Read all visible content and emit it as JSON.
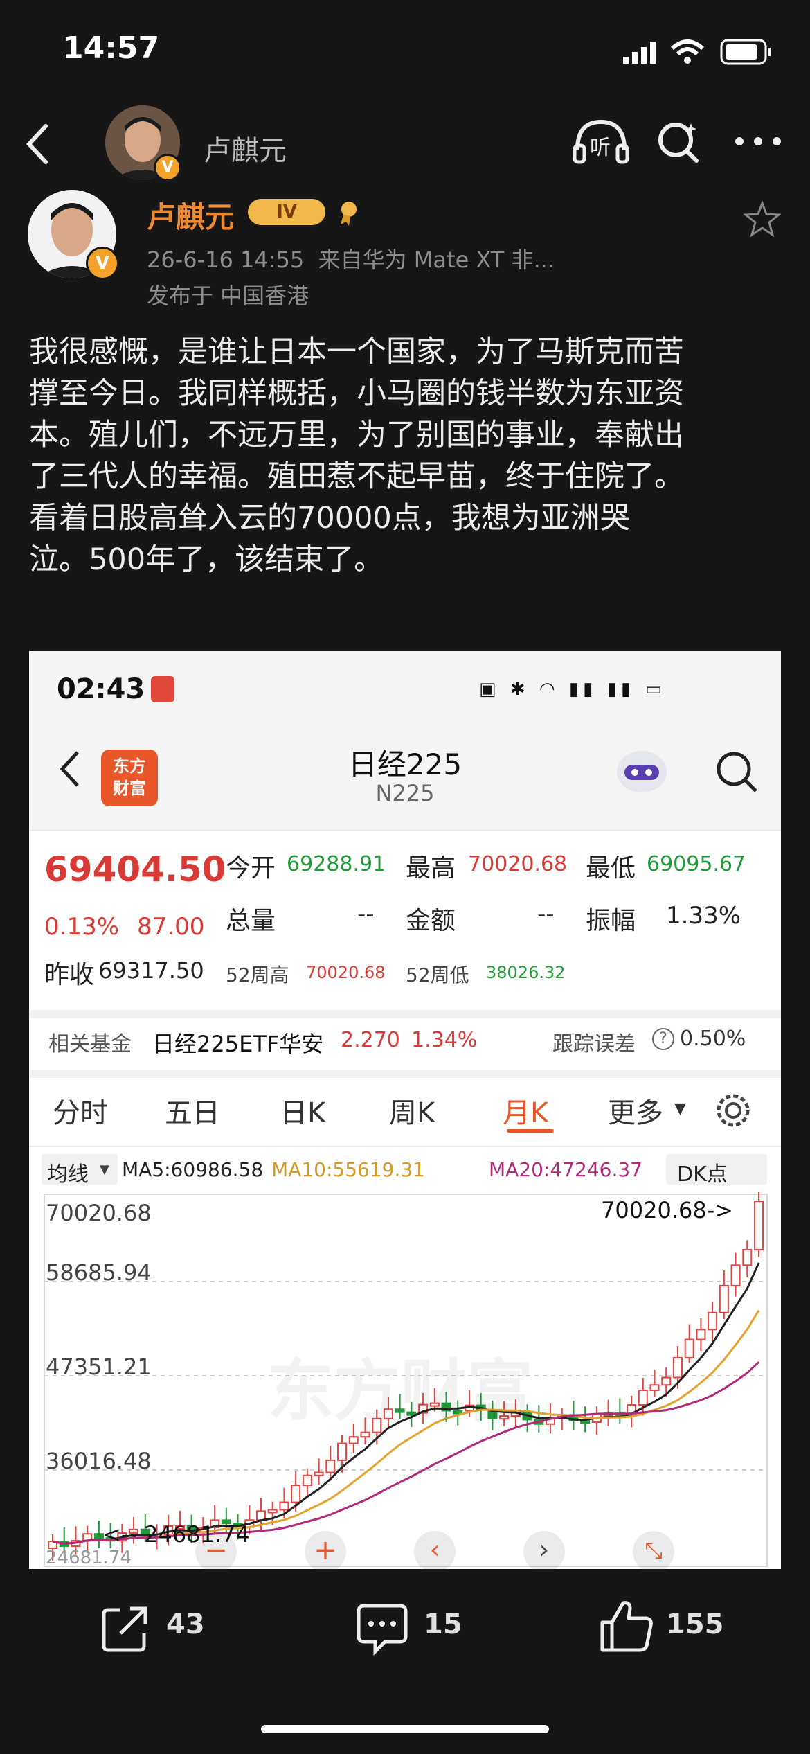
{
  "status_bar": {
    "time": "14:57"
  },
  "nav": {
    "name": "卢麒元",
    "listen_label": "听"
  },
  "post": {
    "author": "卢麒元",
    "level": "IV",
    "time": "26-6-16 14:55",
    "source": "来自华为 Mate XT 非...",
    "location": "发布于 中国香港",
    "text_lines": [
      "我很感慨，是谁让日本一个国家，为了马斯克而苦",
      "撑至今日。我同样概括，小马圈的钱半数为东亚资",
      "本。殖儿们，不远万里，为了别国的事业，奉献出",
      "了三代人的幸福。殖田惹不起早苗，终于住院了。",
      "看着日股高耸入云的70000点，我想为亚洲哭",
      "泣。500年了，该结束了。"
    ]
  },
  "screenshot": {
    "time": "02:43",
    "app_logo": "东方\n财富",
    "title": "日经225",
    "code": "N225",
    "price": "69404.50",
    "change_pct": "0.13%",
    "change": "87.00",
    "prev_close_label": "昨收",
    "prev_close": "69317.50",
    "open_label": "今开",
    "open": "69288.91",
    "high_label": "最高",
    "high": "70020.68",
    "low_label": "最低",
    "low": "69095.67",
    "volume_label": "总量",
    "volume": "--",
    "amount_label": "金额",
    "amount": "--",
    "amplitude_label": "振幅",
    "amplitude": "1.33%",
    "w52_high_label": "52周高",
    "w52_high": "70020.68",
    "w52_low_label": "52周低",
    "w52_low": "38026.32",
    "fund_label": "相关基金",
    "fund_name": "日经225ETF华安",
    "fund_price": "2.270",
    "fund_pct": "1.34%",
    "tracking_label": "跟踪误差",
    "tracking": "0.50%",
    "tabs": [
      "分时",
      "五日",
      "日K",
      "周K",
      "月K",
      "更多"
    ],
    "active_tab": "月K",
    "ma_selector": "均线",
    "ma5": "MA5:60986.58",
    "ma10": "MA10:55619.31",
    "ma20": "MA20:47246.37",
    "dk_label": "DK点",
    "y_labels": [
      "70020.68",
      "58685.94",
      "47351.21",
      "36016.48",
      "24681.74"
    ],
    "max_marker": "70020.68->",
    "min_marker": "<-- 24681.74",
    "watermark": "东方财富",
    "colors": {
      "up": "#e8433e",
      "down": "#1f9b3a",
      "ma5": "#222222",
      "ma10": "#e3a32e",
      "ma20": "#b02a7a"
    }
  },
  "actions": {
    "share": "43",
    "comment": "15",
    "like": "155"
  }
}
